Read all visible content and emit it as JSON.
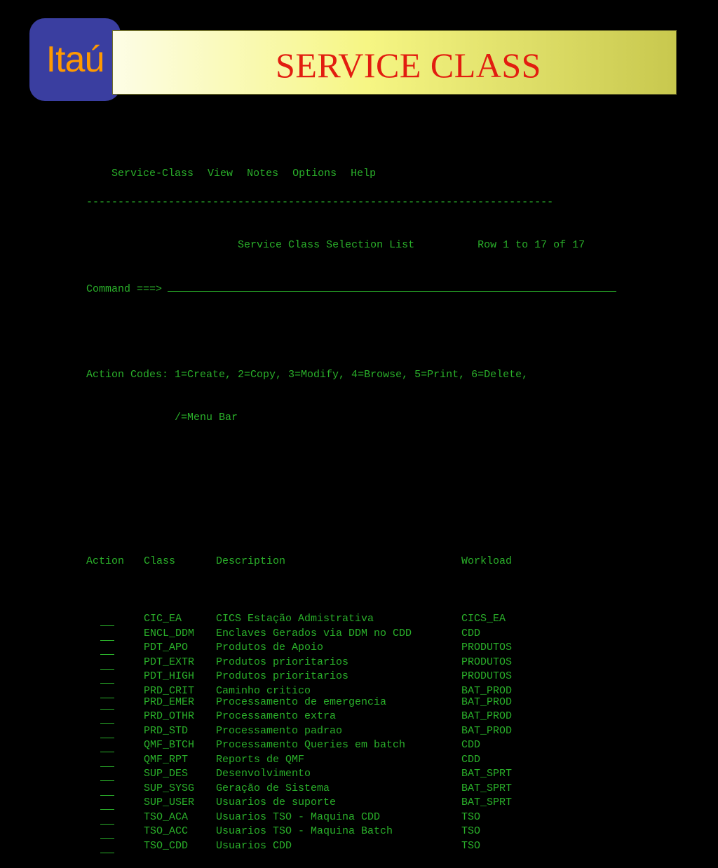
{
  "logo": {
    "text": "Itaú"
  },
  "title": "SERVICE CLASS",
  "menu": [
    "Service-Class",
    "View",
    "Notes",
    "Options",
    "Help"
  ],
  "separator": "--------------------------------------------------------------------------",
  "panel": {
    "heading": "Service Class Selection List",
    "row_info": "Row 1 to 17 of 17",
    "command_label": "Command ===>",
    "action_codes_line1": "Action Codes: 1=Create, 2=Copy, 3=Modify, 4=Browse, 5=Print, 6=Delete,",
    "action_codes_line2": "/=Menu Bar"
  },
  "table": {
    "headers": {
      "action": "Action",
      "class": "Class",
      "description": "Description",
      "workload": "Workload"
    },
    "rows": [
      {
        "class": "CIC_EA",
        "description": "CICS Estação Admistrativa",
        "workload": "CICS_EA"
      },
      {
        "class": "ENCL_DDM",
        "description": "Enclaves Gerados via DDM no CDD",
        "workload": "CDD"
      },
      {
        "class": "PDT_APO",
        "description": "Produtos de Apoio",
        "workload": "PRODUTOS"
      },
      {
        "class": "PDT_EXTR",
        "description": "Produtos prioritarios",
        "workload": "PRODUTOS"
      },
      {
        "class": "PDT_HIGH",
        "description": "Produtos prioritarios",
        "workload": "PRODUTOS"
      },
      {
        "class": "PRD_CRIT",
        "description": "Caminho critico",
        "workload": "BAT_PROD"
      },
      {
        "class": "PRD_EMER",
        "description": "Processamento de emergencia",
        "workload": "BAT_PROD"
      },
      {
        "class": "PRD_OTHR",
        "description": "Processamento extra",
        "workload": "BAT_PROD"
      },
      {
        "class": "PRD_STD",
        "description": "Processamento padrao",
        "workload": "BAT_PROD"
      },
      {
        "class": "QMF_BTCH",
        "description": "Processamento Queries em batch",
        "workload": "CDD"
      },
      {
        "class": "QMF_RPT",
        "description": "Reports de QMF",
        "workload": "CDD"
      },
      {
        "class": "SUP_DES",
        "description": "Desenvolvimento",
        "workload": "BAT_SPRT"
      },
      {
        "class": "SUP_SYSG",
        "description": "Geração de Sistema",
        "workload": "BAT_SPRT"
      },
      {
        "class": "SUP_USER",
        "description": "Usuarios de suporte",
        "workload": "BAT_SPRT"
      },
      {
        "class": "TSO_ACA",
        "description": "Usuarios TSO - Maquina CDD",
        "workload": "TSO"
      },
      {
        "class": "TSO_ACC",
        "description": "Usuarios TSO - Maquina Batch",
        "workload": "TSO"
      },
      {
        "class": "TSO_CDD",
        "description": "Usuarios CDD",
        "workload": "TSO"
      }
    ]
  },
  "colors": {
    "terminal_text": "#2ab02a",
    "title_text": "#e21d10",
    "logo_bg": "#3a3ea0",
    "logo_text": "#ff9900"
  }
}
